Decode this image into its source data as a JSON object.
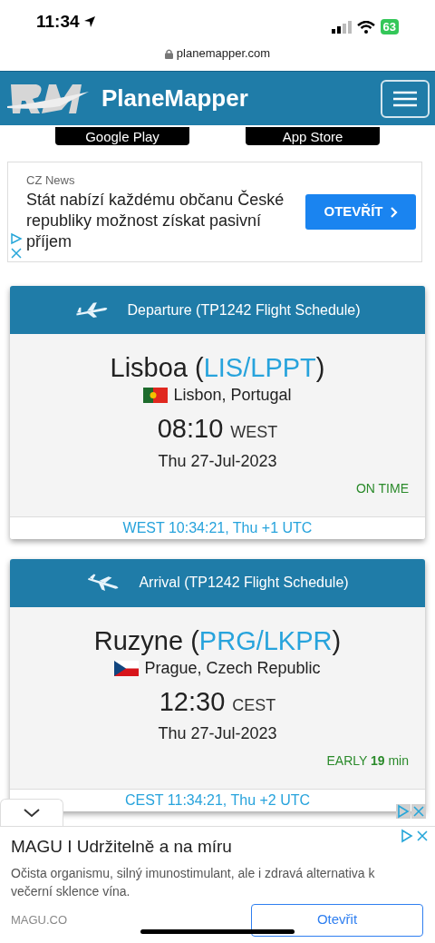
{
  "status_bar": {
    "time": "11:34",
    "battery": "63"
  },
  "browser": {
    "url": "planemapper.com"
  },
  "header": {
    "brand": "PlaneMapper"
  },
  "store_badges": [
    "Google Play",
    "App Store"
  ],
  "top_ad": {
    "source": "CZ News",
    "headline": "Stát nabízí každému občanu České republiky možnost získat pasivní příjem",
    "button": "OTEVŘÍT"
  },
  "flights": [
    {
      "kind": "departure",
      "title": "Departure (TP1242 Flight Schedule)",
      "airport": "Lisboa (",
      "codes": "LIS/LPPT",
      "close": ")",
      "flag": {
        "kind": "portugal"
      },
      "city": "Lisbon, Portugal",
      "time": "08:10",
      "zone": "WEST",
      "date": "Thu 27-Jul-2023",
      "status": "ON TIME",
      "local_time": "WEST 10:34:21, Thu +1 UTC"
    },
    {
      "kind": "arrival",
      "title": "Arrival (TP1242 Flight Schedule)",
      "airport": "Ruzyne (",
      "codes": "PRG/LKPR",
      "close": ")",
      "flag": {
        "kind": "czech"
      },
      "city": "Prague, Czech Republic",
      "time": "12:30",
      "zone": "CEST",
      "date": "Thu 27-Jul-2023",
      "status": "EARLY **19** min",
      "local_time": "CEST 11:34:21, Thu +2 UTC"
    }
  ],
  "bottom_ad": {
    "headline": "MAGU I Udržitelně a na míru",
    "body": "Očista organismu, silný imunostimulant, ale i zdravá alternativa k večerní sklence vína.",
    "domain": "MAGU.CO",
    "button": "Otevřit"
  }
}
